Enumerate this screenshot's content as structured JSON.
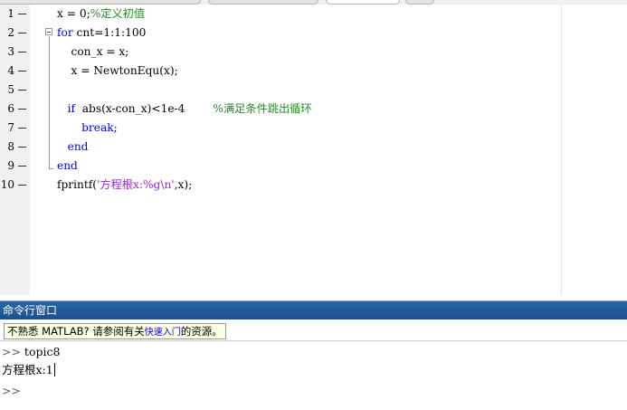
{
  "editor": {
    "lines": [
      {
        "num": "1",
        "segments": [
          {
            "t": "x = 0;",
            "c": ""
          },
          {
            "t": "%定义初值",
            "c": "cm"
          }
        ]
      },
      {
        "num": "2",
        "segments": [
          {
            "t": "for",
            "c": "kw"
          },
          {
            "t": " cnt=1:1:100",
            "c": ""
          }
        ]
      },
      {
        "num": "3",
        "segments": [
          {
            "t": "    con_x = x;",
            "c": ""
          }
        ]
      },
      {
        "num": "4",
        "segments": [
          {
            "t": "    x = NewtonEqu(x);",
            "c": ""
          }
        ]
      },
      {
        "num": "5",
        "segments": []
      },
      {
        "num": "6",
        "segments": [
          {
            "t": "   if",
            "c": "kw"
          },
          {
            "t": "  abs(x-con_x)<1e-4        ",
            "c": ""
          },
          {
            "t": "%满足条件跳出循环",
            "c": "cm"
          }
        ]
      },
      {
        "num": "7",
        "segments": [
          {
            "t": "       break",
            "c": "kw"
          },
          {
            "t": ";",
            "c": ""
          }
        ]
      },
      {
        "num": "8",
        "segments": [
          {
            "t": "   end",
            "c": "kw"
          }
        ]
      },
      {
        "num": "9",
        "segments": [
          {
            "t": "end",
            "c": "kw"
          }
        ]
      },
      {
        "num": "10",
        "segments": [
          {
            "t": "fprintf(",
            "c": ""
          },
          {
            "t": "'方程根x:%g\\n'",
            "c": "st"
          },
          {
            "t": ",x);",
            "c": ""
          }
        ]
      }
    ]
  },
  "command_window": {
    "title": "命令行窗口",
    "notice": {
      "prefix": "不熟悉 MATLAB? 请参阅有关",
      "link": "快速入门",
      "suffix": "的资源。"
    },
    "history": [
      {
        "prompt": ">> ",
        "text": "topic8"
      },
      {
        "prompt": "",
        "text": "方程根x:1"
      }
    ],
    "current_prompt": ">>"
  },
  "colors": {
    "keyword": "#0000ff",
    "comment": "#228b22",
    "string": "#a020f0",
    "cmd_header": "#1b4f8c"
  }
}
